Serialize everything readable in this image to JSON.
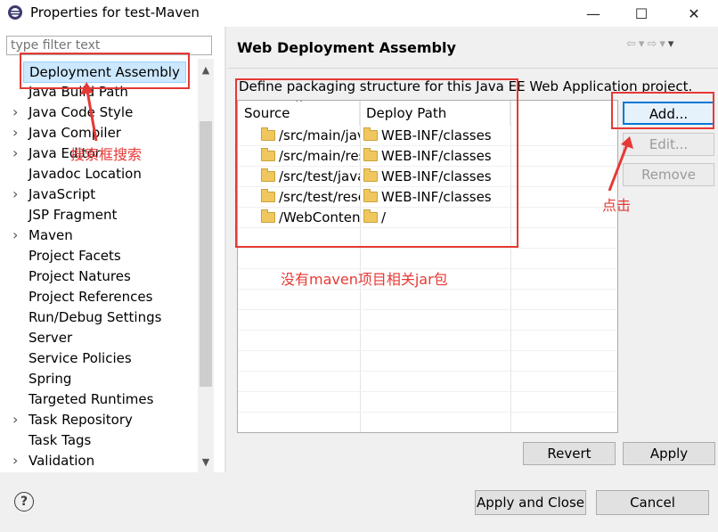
{
  "window": {
    "title": "Properties for test-Maven",
    "minimize": "—",
    "maximize": "☐",
    "close": "✕"
  },
  "filter": {
    "placeholder": "type filter text"
  },
  "tree": {
    "items": [
      {
        "label": "Deployment Assembly",
        "expandable": false,
        "selected": true
      },
      {
        "label": "Java Build Path",
        "expandable": false
      },
      {
        "label": "Java Code Style",
        "expandable": true
      },
      {
        "label": "Java Compiler",
        "expandable": true
      },
      {
        "label": "Java Editor",
        "expandable": true
      },
      {
        "label": "Javadoc Location",
        "expandable": false
      },
      {
        "label": "JavaScript",
        "expandable": true
      },
      {
        "label": "JSP Fragment",
        "expandable": false
      },
      {
        "label": "Maven",
        "expandable": true
      },
      {
        "label": "Project Facets",
        "expandable": false
      },
      {
        "label": "Project Natures",
        "expandable": false
      },
      {
        "label": "Project References",
        "expandable": false
      },
      {
        "label": "Run/Debug Settings",
        "expandable": false
      },
      {
        "label": "Server",
        "expandable": false
      },
      {
        "label": "Service Policies",
        "expandable": false
      },
      {
        "label": "Spring",
        "expandable": false
      },
      {
        "label": "Targeted Runtimes",
        "expandable": false
      },
      {
        "label": "Task Repository",
        "expandable": true
      },
      {
        "label": "Task Tags",
        "expandable": false
      },
      {
        "label": "Validation",
        "expandable": true
      }
    ]
  },
  "page": {
    "heading": "Web Deployment Assembly",
    "description": "Define packaging structure for this Java EE Web Application project.",
    "nav_icons": [
      "back-arrow-icon",
      "back-dropdown-icon",
      "forward-arrow-icon",
      "forward-dropdown-icon",
      "view-menu-icon"
    ]
  },
  "table": {
    "columns": [
      "Source",
      "Deploy Path"
    ],
    "sort_indicator": "^",
    "rows": [
      {
        "source": "/src/main/java",
        "deploy": "WEB-INF/classes"
      },
      {
        "source": "/src/main/resources",
        "deploy": "WEB-INF/classes"
      },
      {
        "source": "/src/test/java",
        "deploy": "WEB-INF/classes"
      },
      {
        "source": "/src/test/resources",
        "deploy": "WEB-INF/classes"
      },
      {
        "source": "/WebContent",
        "deploy": "/"
      }
    ]
  },
  "buttons": {
    "add": "Add...",
    "edit": "Edit...",
    "remove": "Remove",
    "revert": "Revert",
    "apply": "Apply",
    "apply_close": "Apply and Close",
    "cancel": "Cancel",
    "help": "?"
  },
  "annotations": {
    "search_box": "搜索框搜索",
    "no_maven_jar": "没有maven项目相关jar包",
    "click": "点击",
    "color": "#e53935"
  }
}
